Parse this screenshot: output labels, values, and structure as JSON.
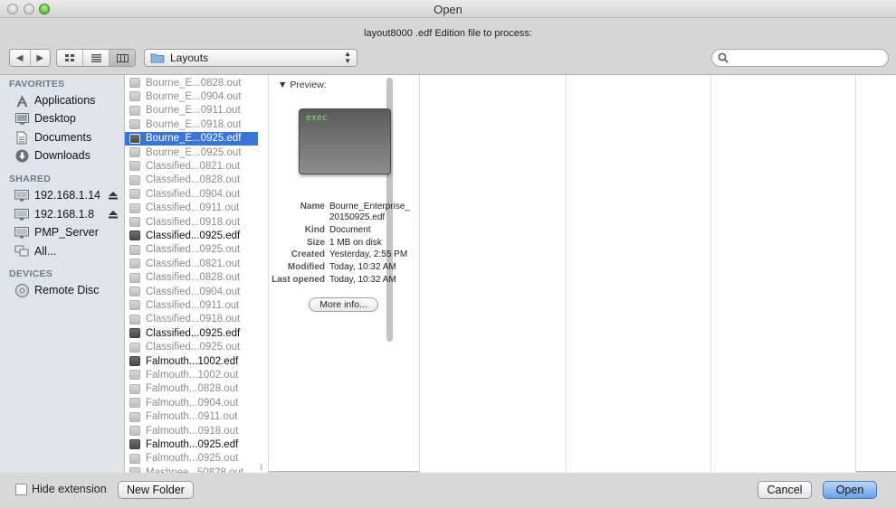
{
  "window": {
    "title": "Open"
  },
  "prompt": "layout8000 .edf Edition file to process:",
  "toolbar": {
    "back_icon": "chevron-left-icon",
    "forward_icon": "chevron-right-icon",
    "views": [
      "icon-view",
      "list-view",
      "column-view"
    ],
    "active_view": "column-view",
    "location": "Layouts",
    "search_placeholder": "",
    "search_value": ""
  },
  "sidebar": {
    "sections": [
      {
        "title": "FAVORITES",
        "items": [
          {
            "label": "Applications",
            "icon": "applications-icon"
          },
          {
            "label": "Desktop",
            "icon": "desktop-icon"
          },
          {
            "label": "Documents",
            "icon": "documents-icon"
          },
          {
            "label": "Downloads",
            "icon": "downloads-icon"
          }
        ]
      },
      {
        "title": "SHARED",
        "items": [
          {
            "label": "192.168.1.14",
            "icon": "network-server-icon",
            "eject": true
          },
          {
            "label": "192.168.1.8",
            "icon": "network-server-icon",
            "eject": true
          },
          {
            "label": "PMP_Server",
            "icon": "network-server-icon"
          },
          {
            "label": "All...",
            "icon": "network-icon"
          }
        ]
      },
      {
        "title": "DEVICES",
        "items": [
          {
            "label": "Remote Disc",
            "icon": "disc-icon"
          }
        ]
      }
    ]
  },
  "files": [
    {
      "name": "Bourne_E...0828.out",
      "type": "out"
    },
    {
      "name": "Bourne_E...0904.out",
      "type": "out"
    },
    {
      "name": "Bourne_E...0911.out",
      "type": "out"
    },
    {
      "name": "Bourne_E...0918.out",
      "type": "out"
    },
    {
      "name": "Bourne_E...0925.edf",
      "type": "edf",
      "selected": true
    },
    {
      "name": "Bourne_E...0925.out",
      "type": "out"
    },
    {
      "name": "Classified...0821.out",
      "type": "out"
    },
    {
      "name": "Classified...0828.out",
      "type": "out"
    },
    {
      "name": "Classified...0904.out",
      "type": "out"
    },
    {
      "name": "Classified...0911.out",
      "type": "out"
    },
    {
      "name": "Classified...0918.out",
      "type": "out"
    },
    {
      "name": "Classified...0925.edf",
      "type": "edf"
    },
    {
      "name": "Classified...0925.out",
      "type": "out"
    },
    {
      "name": "Classified...0821.out",
      "type": "out"
    },
    {
      "name": "Classified...0828.out",
      "type": "out"
    },
    {
      "name": "Classified...0904.out",
      "type": "out"
    },
    {
      "name": "Classified...0911.out",
      "type": "out"
    },
    {
      "name": "Classified...0918.out",
      "type": "out"
    },
    {
      "name": "Classified...0925.edf",
      "type": "edf"
    },
    {
      "name": "Classified...0925.out",
      "type": "out"
    },
    {
      "name": "Falmouth...1002.edf",
      "type": "edf"
    },
    {
      "name": "Falmouth...1002.out",
      "type": "out"
    },
    {
      "name": "Falmouth...0828.out",
      "type": "out"
    },
    {
      "name": "Falmouth...0904.out",
      "type": "out"
    },
    {
      "name": "Falmouth...0911.out",
      "type": "out"
    },
    {
      "name": "Falmouth...0918.out",
      "type": "out"
    },
    {
      "name": "Falmouth...0925.edf",
      "type": "edf"
    },
    {
      "name": "Falmouth...0925.out",
      "type": "out"
    },
    {
      "name": "Mashpee...50828.out",
      "type": "out"
    }
  ],
  "preview": {
    "title": "Preview:",
    "thumbnail_text": "exec",
    "info": [
      {
        "key": "Name",
        "value": "Bourne_Enterprise_"
      },
      {
        "key": "",
        "value": "20150925.edf"
      },
      {
        "key": "Kind",
        "value": "Document"
      },
      {
        "key": "Size",
        "value": "1 MB on disk"
      },
      {
        "key": "Created",
        "value": "Yesterday, 2:55 PM"
      },
      {
        "key": "Modified",
        "value": "Today, 10:32 AM"
      },
      {
        "key": "Last opened",
        "value": "Today, 10:32 AM"
      }
    ],
    "more_info_label": "More info..."
  },
  "footer": {
    "hide_extension_label": "Hide extension",
    "hide_extension_checked": false,
    "new_folder_label": "New Folder",
    "cancel_label": "Cancel",
    "open_label": "Open"
  },
  "colors": {
    "selection": "#3875d7",
    "sidebar_bg": "#dfe4ea",
    "default_button": "#6aa0e8"
  }
}
